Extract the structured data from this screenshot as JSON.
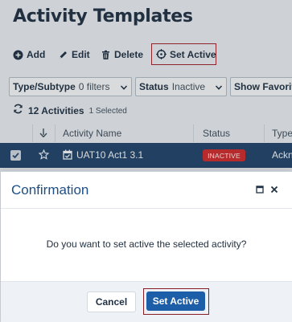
{
  "page": {
    "title": "Activity Templates"
  },
  "toolbar": {
    "add_label": "Add",
    "edit_label": "Edit",
    "delete_label": "Delete",
    "set_active_label": "Set Active"
  },
  "filters": [
    {
      "label": "Type/Subtype",
      "value": "0 filters"
    },
    {
      "label": "Status",
      "value": "Inactive"
    },
    {
      "label": "Show Favorit",
      "value": ""
    }
  ],
  "summary": {
    "count": "12 Activities",
    "selected": "1 Selected"
  },
  "table": {
    "columns": [
      "Activity Name",
      "Status",
      "Type"
    ],
    "rows": [
      {
        "name": "UAT10 Act1 3.1",
        "status": "INACTIVE",
        "type": "Ackn"
      }
    ]
  },
  "dialog": {
    "title": "Confirmation",
    "message": "Do you want to set active the selected activity?",
    "cancel_label": "Cancel",
    "confirm_label": "Set Active"
  },
  "colors": {
    "primary": "#1d5ea8",
    "row_selected": "#22456c",
    "badge_inactive": "#d72a2a",
    "highlight_outline": "#a5202a",
    "title_text": "#1d4f86"
  },
  "icons": {
    "add": "plus-circle-icon",
    "edit": "pencil-icon",
    "delete": "trash-icon",
    "set_active": "crosshair-icon",
    "refresh": "refresh-icon",
    "sort": "arrow-down-icon",
    "favorite": "star-icon",
    "template": "calendar-icon",
    "maximize": "maximize-icon",
    "close": "close-icon"
  }
}
